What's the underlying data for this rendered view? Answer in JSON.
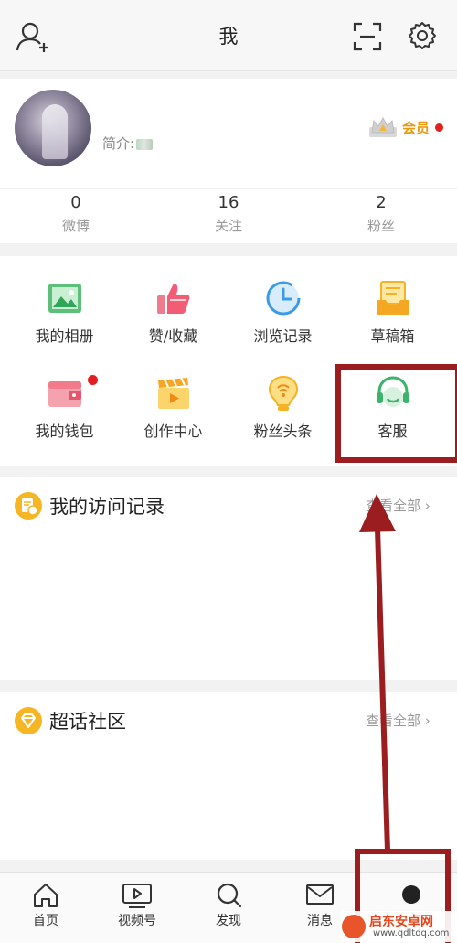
{
  "header": {
    "title": "我"
  },
  "profile": {
    "bio_label": "简介:",
    "vip_label": "会员",
    "stats": [
      {
        "num": "0",
        "label": "微博"
      },
      {
        "num": "16",
        "label": "关注"
      },
      {
        "num": "2",
        "label": "粉丝"
      }
    ]
  },
  "grid": {
    "items": [
      {
        "label": "我的相册",
        "icon": "photo-album-icon"
      },
      {
        "label": "赞/收藏",
        "icon": "thumbs-up-icon"
      },
      {
        "label": "浏览记录",
        "icon": "history-clock-icon"
      },
      {
        "label": "草稿箱",
        "icon": "drafts-icon"
      },
      {
        "label": "我的钱包",
        "icon": "wallet-icon"
      },
      {
        "label": "创作中心",
        "icon": "creator-clapper-icon"
      },
      {
        "label": "粉丝头条",
        "icon": "fan-headline-icon"
      },
      {
        "label": "客服",
        "icon": "customer-service-headset-icon"
      }
    ]
  },
  "sections": {
    "visits": {
      "title": "我的访问记录",
      "more": "查看全部"
    },
    "super_topic": {
      "title": "超话社区",
      "more": "查看全部"
    }
  },
  "tabbar": {
    "items": [
      {
        "label": "首页"
      },
      {
        "label": "视频号"
      },
      {
        "label": "发现"
      },
      {
        "label": "消息"
      }
    ]
  },
  "watermark": {
    "title": "启东安卓网",
    "url": "www.qdltdq.com"
  },
  "colors": {
    "accent_orange": "#e59a12",
    "annotation_red": "#9b1d1f",
    "badge_red": "#e32020"
  }
}
